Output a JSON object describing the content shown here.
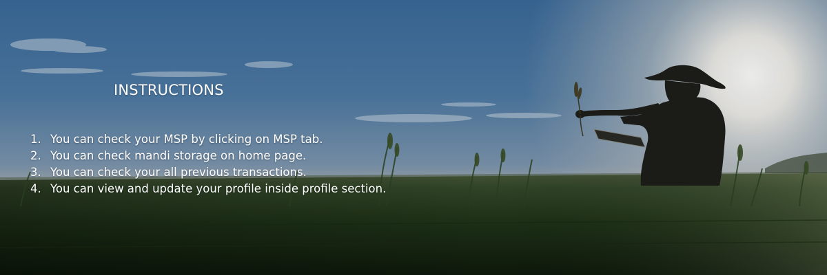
{
  "banner": {
    "image_alt": "farmer-in-wheat-field-at-sunset",
    "colors": {
      "sky_top": "#3d6fa1",
      "sky_mid": "#5d86ad",
      "horizon_glow": "#f3f1ea",
      "field": "#243a1d",
      "text": "#ffffff"
    }
  },
  "instructions": {
    "title": "INSTRUCTIONS",
    "items": [
      {
        "num": "1.",
        "text": "You can check your MSP by clicking on MSP tab."
      },
      {
        "num": "2.",
        "text": "You can check mandi storage on home page."
      },
      {
        "num": "3.",
        "text": "You can check your all previous transactions."
      },
      {
        "num": "4.",
        "text": "You can view and update your profile inside profile section."
      }
    ]
  }
}
